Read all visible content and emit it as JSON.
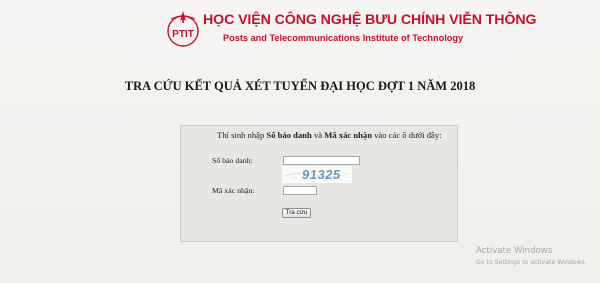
{
  "header": {
    "logo_text": "PTIT",
    "institute_vn": "HỌC VIỆN CÔNG NGHỆ BƯU CHÍNH VIỄN THÔNG",
    "institute_en": "Posts and Telecommunications Institute of Technology"
  },
  "page": {
    "title": "TRA CỨU KẾT QUẢ XÉT TUYỂN ĐẠI HỌC ĐỢT 1 NĂM 2018"
  },
  "form": {
    "instruction_prefix": "Thí sinh nhập ",
    "instruction_sbd": "Số báo danh",
    "instruction_and": " và ",
    "instruction_captcha": "Mã xác nhận",
    "instruction_suffix": " vào các ô dưới đây:",
    "sbd_label": "Số báo danh:",
    "sbd_value": "",
    "captcha_image_text": "91325",
    "captcha_label": "Mã xác nhận:",
    "captcha_value": "",
    "submit_label": "Tra cứu"
  },
  "watermark": {
    "title": "Activate Windows",
    "subtitle": "Go to Settings to activate Windows."
  },
  "colors": {
    "brand": "#c8102e",
    "background": "#f3f1ed",
    "panel": "#e9e7e3",
    "captcha_text": "#5a86a8"
  }
}
